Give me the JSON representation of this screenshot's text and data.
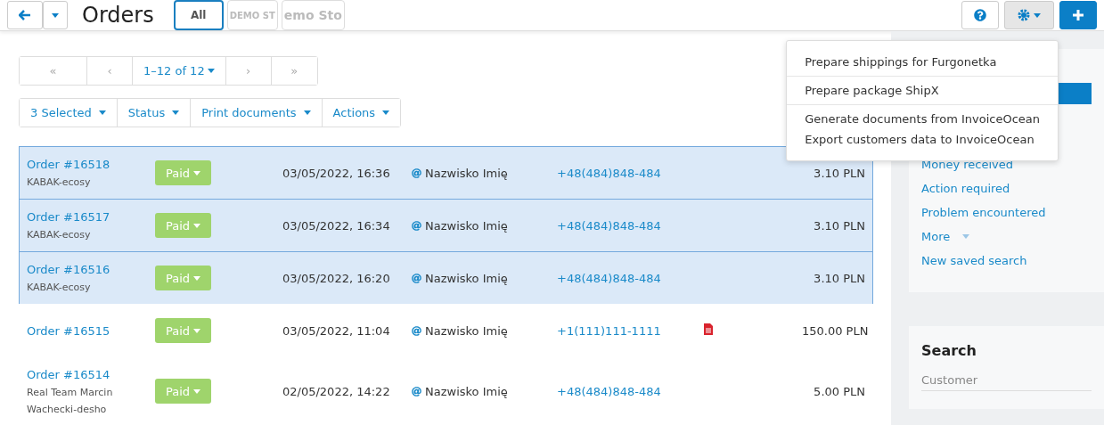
{
  "header": {
    "title": "Orders",
    "storefronts": [
      {
        "label": "All",
        "selected": true
      },
      {
        "label": "DEMO ST",
        "selected": false
      },
      {
        "label": "emo Sto",
        "selected": false
      }
    ]
  },
  "settings_menu": {
    "open": true,
    "groups": [
      [
        "Prepare shippings for Furgonetka"
      ],
      [
        "Prepare package ShipX"
      ],
      [
        "Generate documents from InvoiceOcean",
        "Export customers data to InvoiceOcean"
      ]
    ]
  },
  "pagination": {
    "first": "«",
    "prev": "‹",
    "range": "1–12 of 12",
    "next": "›",
    "last": "»"
  },
  "bulk_actions": [
    "3 Selected",
    "Status",
    "Print documents",
    "Actions"
  ],
  "orders": [
    {
      "order": "Order #16518",
      "store": [
        "KABAK-ecosy"
      ],
      "status": "Paid",
      "date": "03/05/2022, 16:36",
      "customer": "Nazwisko Imię",
      "phone": "+48(484)848-484",
      "document": false,
      "total": "3.10 PLN",
      "selected": true
    },
    {
      "order": "Order #16517",
      "store": [
        "KABAK-ecosy"
      ],
      "status": "Paid",
      "date": "03/05/2022, 16:34",
      "customer": "Nazwisko Imię",
      "phone": "+48(484)848-484",
      "document": false,
      "total": "3.10 PLN",
      "selected": true
    },
    {
      "order": "Order #16516",
      "store": [
        "KABAK-ecosy"
      ],
      "status": "Paid",
      "date": "03/05/2022, 16:20",
      "customer": "Nazwisko Imię",
      "phone": "+48(484)848-484",
      "document": false,
      "total": "3.10 PLN",
      "selected": true
    },
    {
      "order": "Order #16515",
      "status": "Paid",
      "date": "03/05/2022, 11:04",
      "customer": "Nazwisko Imię",
      "phone": "+1(111)111-1111",
      "document": true,
      "total": "150.00 PLN",
      "selected": false
    },
    {
      "order": "Order #16514",
      "store": [
        "Real Team Marcin",
        "Wachecki-desho"
      ],
      "status": "Paid",
      "date": "02/05/2022, 14:22",
      "customer": "Nazwisko Imię",
      "phone": "+48(484)848-484",
      "document": false,
      "total": "5.00 PLN",
      "selected": false
    }
  ],
  "saved_searches": {
    "items": [
      {
        "selected": true
      },
      {
        "label": "Money received",
        "selected": false
      },
      {
        "label": "Action required",
        "selected": false
      },
      {
        "label": "Problem encountered",
        "selected": false
      }
    ],
    "more": "More",
    "new": "New saved search"
  },
  "search": {
    "title": "Search",
    "customer_placeholder": "Customer"
  }
}
